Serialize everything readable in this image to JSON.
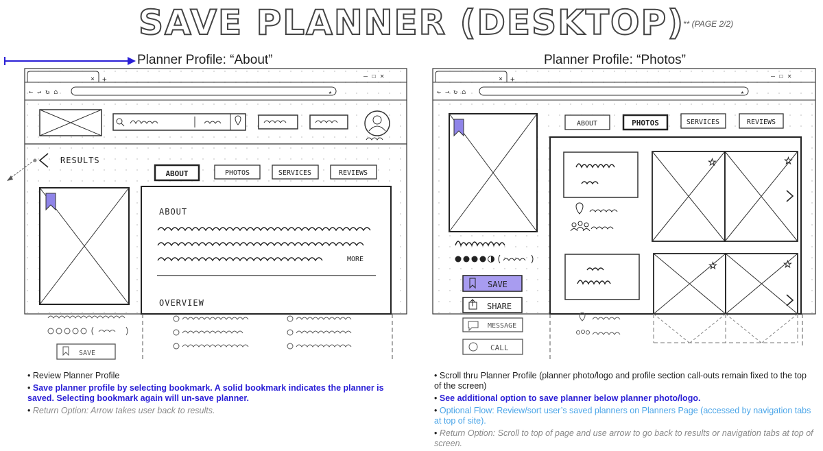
{
  "header": {
    "title": "SAVE PLANNER (DESKTOP)",
    "page_note": "** (PAGE 2/2)"
  },
  "left_panel": {
    "heading": "Planner Profile: “About”",
    "back_label": "RESULTS",
    "tabs": [
      "ABOUT",
      "PHOTOS",
      "SERVICES",
      "REVIEWS"
    ],
    "section_about": "ABOUT",
    "more_link": "MORE",
    "section_overview": "OVERVIEW",
    "save_label": "SAVE",
    "notes": [
      "Review Planner Profile",
      "Save planner profile by selecting bookmark. A solid bookmark indicates the planner is saved. Selecting bookmark again will un-save planner.",
      "Return Option: Arrow takes user back to results."
    ]
  },
  "right_panel": {
    "heading": "Planner Profile: “Photos”",
    "tabs": [
      "ABOUT",
      "PHOTOS",
      "SERVICES",
      "REVIEWS"
    ],
    "save_label": "SAVE",
    "share_label": "SHARE",
    "message_label": "MESSAGE",
    "call_label": "CALL",
    "notes": {
      "scroll_main": "Scroll thru Planner Profile",
      "scroll_detail": "(planner photo/logo and profile section call-outs remain fixed to the top of the screen)",
      "additional_save": "See additional option to save planner below planner photo/logo.",
      "optional_flow": "Optional Flow: Review/sort user’s saved planners on Planners Page",
      "optional_flow_detail": "(accessed by navigation tabs at top of site).",
      "return_option": "Return Option: Scroll to top of page and use arrow to go back to results or navigation tabs at top of screen."
    }
  },
  "colors": {
    "arrow": "#2a1fd6",
    "save_fill": "#a89cf0",
    "bookmark": "#8f84e8",
    "note_blue": "#2a1fd6",
    "note_light_blue": "#4aa5e8",
    "note_gray": "#8a8a8a"
  }
}
